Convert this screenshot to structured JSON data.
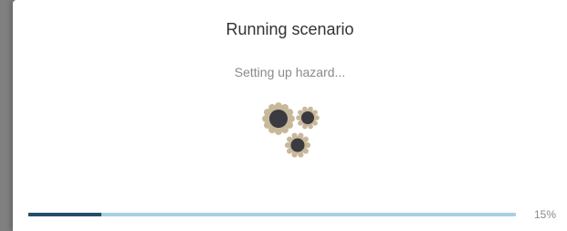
{
  "dialog": {
    "title": "Running scenario",
    "status_text": "Setting up hazard...",
    "spinner_icon": "gears-icon",
    "progress": {
      "percent": 15,
      "label": "15%",
      "fill_color": "#244e68",
      "track_color": "#a9cfe6"
    },
    "gear_colors": {
      "teeth": "#c8b89a",
      "body": "#3a3a40"
    }
  }
}
